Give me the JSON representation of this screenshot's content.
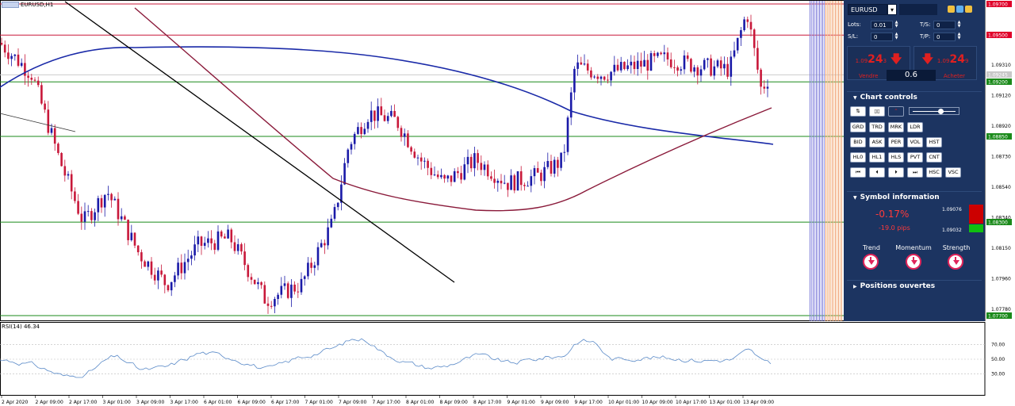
{
  "chart": {
    "symbol_title": "EURUSD,H1",
    "rsi_title": "RSI(14) 46.34",
    "price_axis": [
      "1.09700",
      "1.09510",
      "1.09310",
      "1.09120",
      "1.08920",
      "1.08730",
      "1.08540",
      "1.08340",
      "1.08150",
      "1.07960",
      "1.07780"
    ],
    "price_tags": [
      {
        "text": "1.09700",
        "color": "#e0002a"
      },
      {
        "text": "1.09500",
        "color": "#e0002a"
      },
      {
        "text": "1.09245",
        "color": "#c8c8c8"
      },
      {
        "text": "1.09200",
        "color": "#1a8a1a"
      },
      {
        "text": "1.08850",
        "color": "#1a8a1a"
      },
      {
        "text": "1.08300",
        "color": "#1a8a1a"
      },
      {
        "text": "1.07700",
        "color": "#1a8a1a"
      }
    ],
    "rsi_axis": [
      "70.00",
      "50.00",
      "30.00"
    ],
    "time_axis": [
      "2 Apr 2020",
      "2 Apr 09:00",
      "2 Apr 17:00",
      "3 Apr 01:00",
      "3 Apr 09:00",
      "3 Apr 17:00",
      "6 Apr 01:00",
      "6 Apr 09:00",
      "6 Apr 17:00",
      "7 Apr 01:00",
      "7 Apr 09:00",
      "7 Apr 17:00",
      "8 Apr 01:00",
      "8 Apr 09:00",
      "8 Apr 17:00",
      "9 Apr 01:00",
      "9 Apr 09:00",
      "9 Apr 17:00",
      "10 Apr 01:00",
      "10 Apr 09:00",
      "10 Apr 17:00",
      "13 Apr 01:00",
      "13 Apr 09:00"
    ],
    "colors": {
      "bull": "#1a1aa8",
      "bear": "#c8183a",
      "ma_fast": "#8a1a3a",
      "ma_slow": "#1a2aa8",
      "hline_red": "#c8183a",
      "hline_green": "#1a8a1a",
      "rsi": "#5a8ac8"
    }
  },
  "panel": {
    "symbol": "EURUSD",
    "dropdown_glyph": "▾",
    "lots_label": "Lots:",
    "lots_value": "0.01",
    "sl_label": "S/L:",
    "sl_value": "0",
    "ts_label": "T/S:",
    "ts_value": "0",
    "tp_label": "T/P:",
    "tp_value": "0",
    "sell_price_main": "24",
    "sell_price_prefix": "1.09",
    "sell_price_suffix": "3",
    "sell_label": "Vendre",
    "buy_price_main": "24",
    "buy_price_prefix": "1.09",
    "buy_price_suffix": "9",
    "buy_label": "Acheter",
    "lot_display": "0.6",
    "chart_controls_title": "Chart controls",
    "ctl_row2": [
      "GRD",
      "TRD",
      "MRK",
      "LDR"
    ],
    "ctl_row3": [
      "BID",
      "ASK",
      "PER",
      "VOL",
      "HST"
    ],
    "ctl_row4": [
      "HL0",
      "HL1",
      "HLS",
      "PVT",
      "CNT"
    ],
    "ctl_row5": [
      "⏮",
      "⏴",
      "⏵",
      "⏭",
      "HSC",
      "VSC"
    ],
    "symbol_info_title": "Symbol information",
    "change_pct": "-0.17%",
    "change_pips": "-19.0 pips",
    "info_high": "1.09076",
    "info_low": "1.09032",
    "trend_label": "Trend",
    "momentum_label": "Momentum",
    "strength_label": "Strength",
    "positions_title": "Positions ouvertes"
  }
}
